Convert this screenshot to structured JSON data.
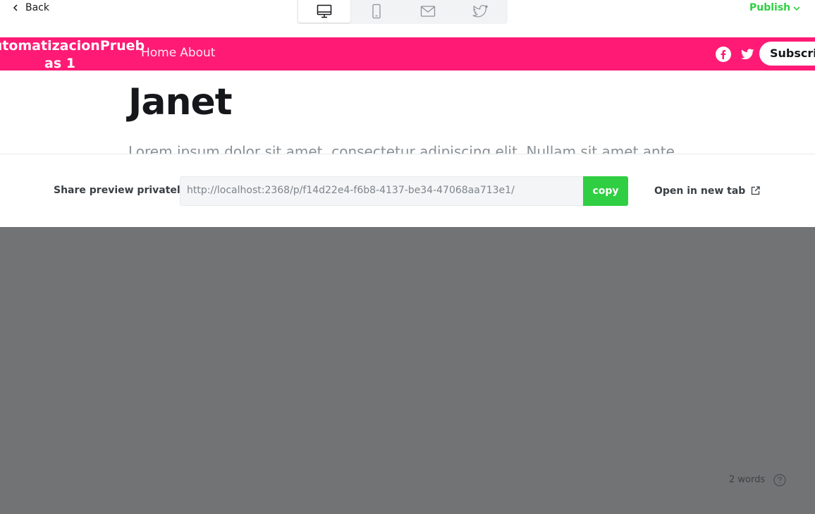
{
  "toolbar": {
    "back_label": "Back",
    "devices": [
      {
        "name": "desktop",
        "icon": "desktop-icon",
        "active": true
      },
      {
        "name": "mobile",
        "icon": "mobile-icon",
        "active": false
      },
      {
        "name": "email",
        "icon": "mail-icon",
        "active": false
      },
      {
        "name": "twitter",
        "icon": "twitter-icon",
        "active": false
      }
    ],
    "publish_label": "Publish"
  },
  "site": {
    "title_line1": "AutomatizacionPrueb",
    "title_line2": "as 1",
    "nav": [
      "Home",
      "About"
    ],
    "social_icons": [
      "facebook-icon",
      "twitter-icon"
    ],
    "subscribe_label": "Subscribe",
    "accent_color": "#ff1a75"
  },
  "post": {
    "title": "Janet",
    "excerpt": "Lorem ipsum dolor sit amet, consectetur adipiscing elit. Nullam sit amet ante"
  },
  "share": {
    "label": "Share preview privately",
    "url": "http://localhost:2368/p/f14d22e4-f6b8-4137-be34-47068aa713e1/",
    "copy_label": "copy",
    "open_label": "Open in new tab"
  },
  "status": {
    "word_count": "2 words",
    "help_icon": "question-circle-icon"
  },
  "colors": {
    "publish": "#30cf43",
    "copy_button": "#30cf43",
    "overlay": "#727375"
  }
}
